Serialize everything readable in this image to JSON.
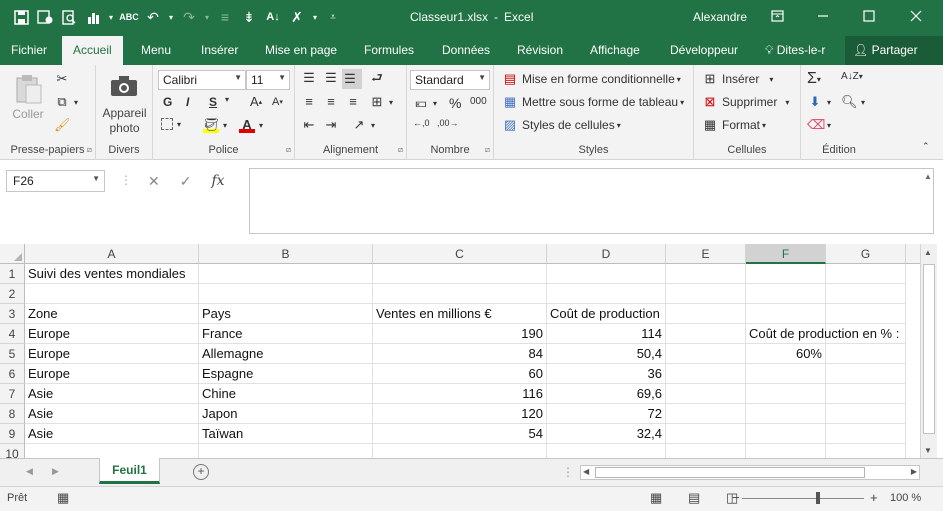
{
  "window": {
    "filename": "Classeur1.xlsx",
    "separator": "-",
    "app": "Excel",
    "user": "Alexandre",
    "accent_color": "#217346"
  },
  "quick_access": {
    "icons": [
      "save-icon",
      "autosave-icon",
      "print-preview-icon",
      "chart-icon",
      "spelling-icon",
      "undo-icon",
      "redo-icon",
      "indent-icon",
      "format-icon",
      "sort-icon",
      "clear-icon",
      "customize-icon"
    ]
  },
  "tabs": {
    "items": [
      "Fichier",
      "Accueil",
      "Menu",
      "Insérer",
      "Mise en page",
      "Formules",
      "Données",
      "Révision",
      "Affichage",
      "Développeur"
    ],
    "active": "Accueil",
    "tell_me": "Dites-le-r",
    "share": "Partager"
  },
  "ribbon": {
    "clipboard": {
      "label": "Presse-papiers",
      "paste": "Coller"
    },
    "services": {
      "label": "Divers",
      "camera_line1": "Appareil",
      "camera_line2": "photo"
    },
    "font": {
      "label": "Police",
      "name": "Calibri",
      "size": "11",
      "bold": "G",
      "italic": "I",
      "underline": "S",
      "grow": "A",
      "shrink": "A"
    },
    "alignment": {
      "label": "Alignement"
    },
    "number": {
      "label": "Nombre",
      "format": "Standard",
      "percent": "%",
      "thousands": "000"
    },
    "styles": {
      "label": "Styles",
      "conditional": "Mise en forme conditionnelle",
      "table": "Mettre sous forme de tableau",
      "cell_styles": "Styles de cellules"
    },
    "cells": {
      "label": "Cellules",
      "insert": "Insérer",
      "delete": "Supprimer",
      "format": "Format"
    },
    "editing": {
      "label": "Édition"
    }
  },
  "formula_bar": {
    "name_box": "F26",
    "cancel": "✕",
    "enter": "✓",
    "fx": "fx",
    "content": ""
  },
  "sheet": {
    "columns": [
      "A",
      "B",
      "C",
      "D",
      "E",
      "F",
      "G"
    ],
    "selected_column": "F",
    "rows": [
      "1",
      "2",
      "3",
      "4",
      "5",
      "6",
      "7",
      "8",
      "9",
      "10"
    ],
    "cells": {
      "A1": "Suivi des ventes mondiales",
      "A3": "Zone",
      "B3": "Pays",
      "C3": "Ventes en millions €",
      "D3": "Coût de production",
      "A4": "Europe",
      "B4": "France",
      "C4": "190",
      "D4": "114",
      "F4": "Coût de production en % :",
      "A5": "Europe",
      "B5": "Allemagne",
      "C5": "84",
      "D5": "50,4",
      "F5": "60%",
      "A6": "Europe",
      "B6": "Espagne",
      "C6": "60",
      "D6": "36",
      "A7": "Asie",
      "B7": "Chine",
      "C7": "116",
      "D7": "69,6",
      "A8": "Asie",
      "B8": "Japon",
      "C8": "120",
      "D8": "72",
      "A9": "Asie",
      "B9": "Taïwan",
      "C9": "54",
      "D9": "32,4"
    }
  },
  "sheet_tabs": {
    "active": "Feuil1",
    "add": "+"
  },
  "status": {
    "mode": "Prêt",
    "zoom": "100 %",
    "zoom_minus": "−",
    "zoom_plus": "+"
  }
}
